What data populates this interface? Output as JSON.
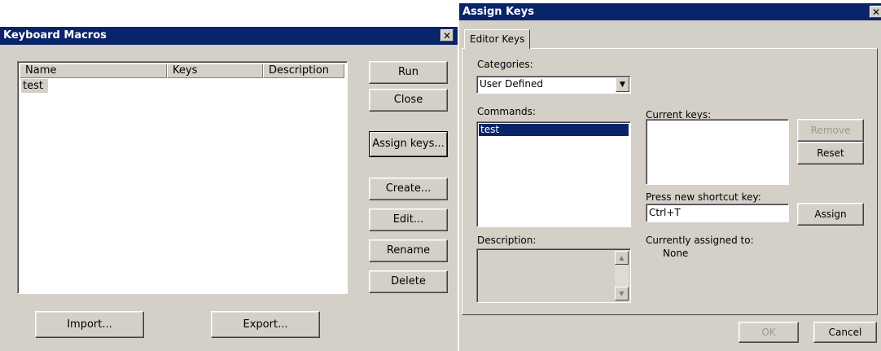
{
  "macros": {
    "title": "Keyboard Macros",
    "columns": [
      "Name",
      "Keys",
      "Description"
    ],
    "rows": [
      {
        "name": "test",
        "keys": "",
        "description": ""
      }
    ],
    "buttons": {
      "run": "Run",
      "close": "Close",
      "assign_keys": "Assign keys...",
      "create": "Create...",
      "edit": "Edit...",
      "rename": "Rename",
      "delete": "Delete",
      "import": "Import...",
      "export": "Export..."
    }
  },
  "assign": {
    "title": "Assign Keys",
    "tab": "Editor Keys",
    "categories_label": "Categories:",
    "category_value": "User Defined",
    "commands_label": "Commands:",
    "commands": [
      "test"
    ],
    "current_keys_label": "Current keys:",
    "remove": "Remove",
    "reset": "Reset",
    "press_shortcut_label": "Press new shortcut key:",
    "shortcut_value": "Ctrl+T",
    "assign": "Assign",
    "description_label": "Description:",
    "currently_assigned_label": "Currently assigned to:",
    "currently_assigned_value": "None",
    "ok": "OK",
    "cancel": "Cancel"
  },
  "icons": {
    "close": "close-icon",
    "dropdown": "chevron-down-icon",
    "scroll_up": "arrow-up-icon",
    "scroll_down": "arrow-down-icon"
  },
  "colors": {
    "titlebar": "#0a246a",
    "face": "#d4d0c8",
    "selection": "#0a246a"
  }
}
